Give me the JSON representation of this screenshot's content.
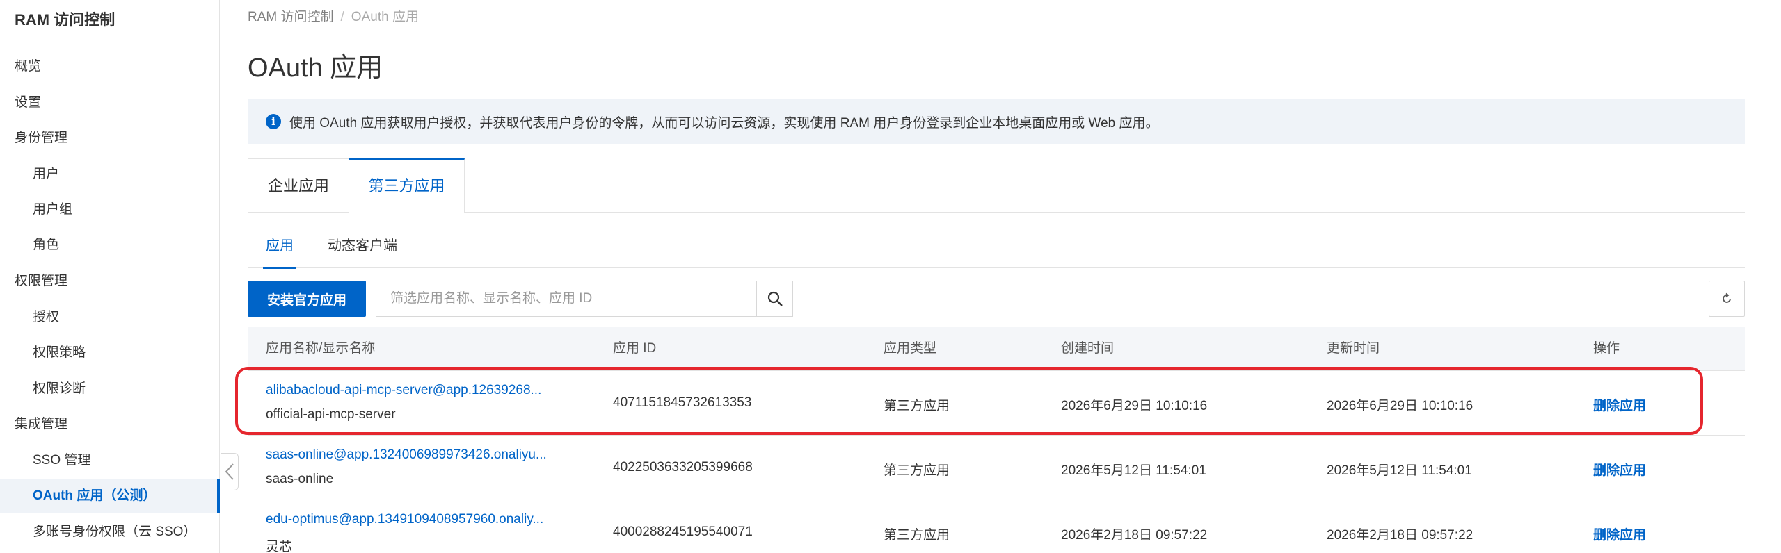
{
  "sidebar": {
    "title": "RAM 访问控制",
    "items": [
      {
        "label": "概览",
        "sub": false
      },
      {
        "label": "设置",
        "sub": false
      },
      {
        "label": "身份管理",
        "sub": false
      },
      {
        "label": "用户",
        "sub": true
      },
      {
        "label": "用户组",
        "sub": true
      },
      {
        "label": "角色",
        "sub": true
      },
      {
        "label": "权限管理",
        "sub": false
      },
      {
        "label": "授权",
        "sub": true
      },
      {
        "label": "权限策略",
        "sub": true
      },
      {
        "label": "权限诊断",
        "sub": true
      },
      {
        "label": "集成管理",
        "sub": false
      },
      {
        "label": "SSO 管理",
        "sub": true
      },
      {
        "label": "OAuth 应用（公测）",
        "sub": true,
        "active": true
      },
      {
        "label": "多账号身份权限（云 SSO）",
        "sub": true
      }
    ]
  },
  "breadcrumb": {
    "root": "RAM 访问控制",
    "separator": "/",
    "current": "OAuth 应用"
  },
  "page_title": "OAuth 应用",
  "notice": {
    "icon": "info-icon",
    "text": "使用 OAuth 应用获取用户授权，并获取代表用户身份的令牌，从而可以访问云资源，实现使用 RAM 用户身份登录到企业本地桌面应用或 Web 应用。"
  },
  "tabs": [
    {
      "label": "企业应用",
      "active": false
    },
    {
      "label": "第三方应用",
      "active": true
    }
  ],
  "subtabs": [
    {
      "label": "应用",
      "active": true
    },
    {
      "label": "动态客户端",
      "active": false
    }
  ],
  "toolbar": {
    "install_label": "安装官方应用",
    "search_placeholder": "筛选应用名称、显示名称、应用 ID",
    "search_icon": "search-icon",
    "refresh_icon": "refresh-icon"
  },
  "table": {
    "headers": [
      "应用名称/显示名称",
      "应用 ID",
      "应用类型",
      "创建时间",
      "更新时间",
      "操作"
    ],
    "rows": [
      {
        "name": "alibabacloud-api-mcp-server@app.12639268...",
        "display": "official-api-mcp-server",
        "id": "4071151845732613353",
        "type": "第三方应用",
        "created": "2026年6月29日 10:10:16",
        "updated": "2026年6月29日 10:10:16",
        "action": "删除应用"
      },
      {
        "name": "saas-online@app.1324006989973426.onaliyu...",
        "display": "saas-online",
        "id": "4022503633205399668",
        "type": "第三方应用",
        "created": "2026年5月12日 11:54:01",
        "updated": "2026年5月12日 11:54:01",
        "action": "删除应用"
      },
      {
        "name": "edu-optimus@app.1349109408957960.onaliy...",
        "display": "灵芯",
        "id": "4000288245195540071",
        "type": "第三方应用",
        "created": "2026年2月18日 09:57:22",
        "updated": "2026年2月18日 09:57:22",
        "action": "删除应用"
      }
    ]
  },
  "colors": {
    "accent": "#0064c8",
    "highlight": "#e5262e",
    "notice_bg": "#eff3f8"
  }
}
